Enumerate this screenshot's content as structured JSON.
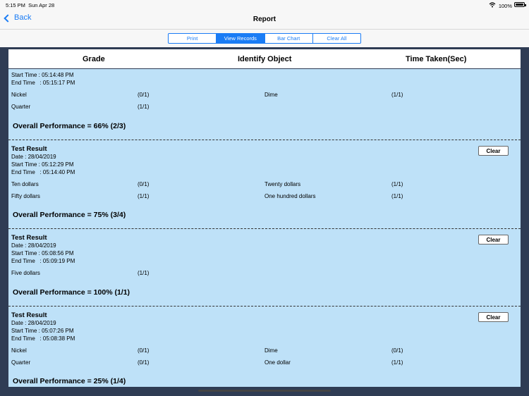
{
  "status_bar": {
    "time": "5:15 PM",
    "date": "Sun Apr 28",
    "battery": "100%"
  },
  "nav": {
    "back_label": "Back",
    "title": "Report"
  },
  "segments": [
    "Print",
    "View Records",
    "Bar Chart",
    "Clear All"
  ],
  "active_segment": "View Records",
  "table_header": {
    "grade": "Grade",
    "identify": "Identify Object",
    "time": "Time Taken(Sec)"
  },
  "clear_label": "Clear",
  "records": [
    {
      "start": "Start Time : 05:14:48 PM",
      "end": "End Time   : 05:15:17 PM",
      "items": [
        {
          "name": "Nickel",
          "score": "(0/1)"
        },
        {
          "name": "Dime",
          "score": "(1/1)"
        },
        {
          "name": "Quarter",
          "score": "(1/1)"
        }
      ],
      "overall": "Overall Performance = 66% (2/3)"
    },
    {
      "title": "Test Result",
      "date": "Date : 28/04/2019",
      "start": "Start Time : 05:12:29 PM",
      "end": "End Time   : 05:14:40 PM",
      "items": [
        {
          "name": "Ten dollars",
          "score": "(0/1)"
        },
        {
          "name": "Twenty dollars",
          "score": "(1/1)"
        },
        {
          "name": "Fifty dollars",
          "score": "(1/1)"
        },
        {
          "name": "One hundred dollars",
          "score": "(1/1)"
        }
      ],
      "overall": "Overall Performance = 75% (3/4)"
    },
    {
      "title": "Test Result",
      "date": "Date : 28/04/2019",
      "start": "Start Time : 05:08:56 PM",
      "end": "End Time   : 05:09:19 PM",
      "items": [
        {
          "name": "Five dollars",
          "score": "(1/1)"
        }
      ],
      "overall": "Overall Performance = 100% (1/1)"
    },
    {
      "title": "Test Result",
      "date": "Date : 28/04/2019",
      "start": "Start Time : 05:07:26 PM",
      "end": "End Time   : 05:08:38 PM",
      "items": [
        {
          "name": "Nickel",
          "score": "(0/1)"
        },
        {
          "name": "Dime",
          "score": "(0/1)"
        },
        {
          "name": "Quarter",
          "score": "(0/1)"
        },
        {
          "name": "One dollar",
          "score": "(1/1)"
        }
      ],
      "overall": "Overall Performance = 25% (1/4)"
    }
  ],
  "colors": {
    "accent": "#1a7cf5",
    "record_bg": "#bee1f8",
    "frame": "#2f3c54"
  }
}
